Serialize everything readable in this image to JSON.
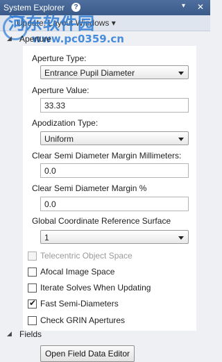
{
  "window": {
    "title": "System Explorer",
    "help_glyph": "?",
    "pin_glyph": "▾",
    "close_glyph": "✕"
  },
  "watermark": {
    "line1": "河东软件园",
    "line2": "www.pc0359.cn"
  },
  "update_bar": {
    "text": "Update: Layout Windows ▾"
  },
  "sections": {
    "aperture": {
      "label": "Aperture",
      "arrow": "◢"
    },
    "fields": {
      "label": "Fields",
      "arrow": "◢"
    }
  },
  "aperture": {
    "aperture_type_label": "Aperture Type:",
    "aperture_type_value": "Entrance Pupil Diameter",
    "aperture_value_label": "Aperture Value:",
    "aperture_value": "33.33",
    "apodization_type_label": "Apodization Type:",
    "apodization_type_value": "Uniform",
    "clear_semi_mm_label": "Clear Semi Diameter Margin Millimeters:",
    "clear_semi_mm_value": "0.0",
    "clear_semi_pct_label": "Clear Semi Diameter Margin %",
    "clear_semi_pct_value": "0.0",
    "global_ref_label": "Global Coordinate Reference Surface",
    "global_ref_value": "1",
    "checkboxes": [
      {
        "label": "Telecentric Object Space",
        "checked": false,
        "disabled": true
      },
      {
        "label": "Afocal Image Space",
        "checked": false,
        "disabled": false
      },
      {
        "label": "Iterate Solves When Updating",
        "checked": false,
        "disabled": false
      },
      {
        "label": "Fast Semi-Diameters",
        "checked": true,
        "disabled": false
      },
      {
        "label": "Check GRIN Apertures",
        "checked": false,
        "disabled": false
      }
    ],
    "check_glyph": "✔"
  },
  "fields": {
    "open_editor_label": "Open Field Data Editor"
  }
}
